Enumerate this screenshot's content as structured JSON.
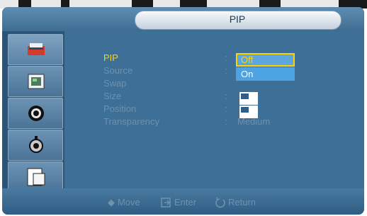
{
  "title": "PIP",
  "menu": [
    {
      "label": "PIP",
      "value": "",
      "selected": true
    },
    {
      "label": "Source",
      "value": "",
      "selected": false
    },
    {
      "label": "Swap",
      "value": "",
      "selected": false
    },
    {
      "label": "Size",
      "value": "",
      "selected": false
    },
    {
      "label": "Position",
      "value": "",
      "selected": false
    },
    {
      "label": "Transparency",
      "value": "Medium",
      "selected": false
    }
  ],
  "dropdown": {
    "options": [
      "Off",
      "On"
    ],
    "highlighted": "Off"
  },
  "sidebar_icons": [
    "picture-icon",
    "sound-icon",
    "setup-icon",
    "multi-window-icon"
  ],
  "help": {
    "move": "Move",
    "enter": "Enter",
    "return": "Return"
  },
  "colors": {
    "highlight": "#ffd200",
    "dropdown": "#5ba7de",
    "panel": "#3e6f96"
  }
}
